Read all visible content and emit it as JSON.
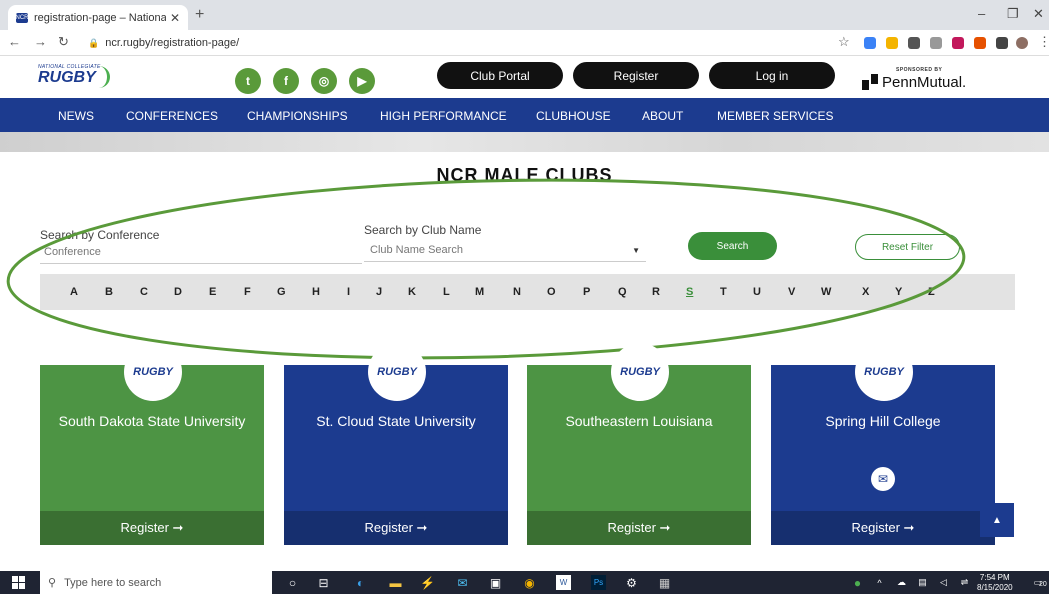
{
  "browser": {
    "tab_title": "registration-page – National Coll",
    "tab_favicon": "NCR",
    "url": "ncr.rugby/registration-page/"
  },
  "header": {
    "logo_small": "NATIONAL COLLEGIATE",
    "logo_big": "RUGBY",
    "social": [
      "twitter-icon",
      "facebook-icon",
      "instagram-icon",
      "youtube-icon"
    ],
    "club_portal": "Club Portal",
    "register": "Register",
    "login": "Log in",
    "sponsor_label": "SPONSORED BY",
    "sponsor_name": "PennMutual."
  },
  "nav": [
    "NEWS",
    "CONFERENCES",
    "CHAMPIONSHIPS",
    "HIGH PERFORMANCE",
    "CLUBHOUSE",
    "ABOUT",
    "MEMBER SERVICES"
  ],
  "page_title": "NCR MALE CLUBS",
  "filters": {
    "conference_label": "Search by Conference",
    "conference_placeholder": "Conference",
    "club_label": "Search by Club Name",
    "club_placeholder": "Club Name Search",
    "search_btn": "Search",
    "reset_btn": "Reset Filter"
  },
  "alphabet": [
    "A",
    "B",
    "C",
    "D",
    "E",
    "F",
    "G",
    "H",
    "I",
    "J",
    "K",
    "L",
    "M",
    "N",
    "O",
    "P",
    "Q",
    "R",
    "S",
    "T",
    "U",
    "V",
    "W",
    "X",
    "Y",
    "Z"
  ],
  "active_letter": "S",
  "cards": [
    {
      "name": "South Dakota State University",
      "register": "Register  ➞",
      "theme": "green"
    },
    {
      "name": "St. Cloud State University",
      "register": "Register  ➞",
      "theme": "blue"
    },
    {
      "name": "Southeastern Louisiana",
      "register": "Register  ➞",
      "theme": "green"
    },
    {
      "name": "Spring Hill College",
      "register": "Register  ➞",
      "theme": "blue"
    }
  ],
  "card_logo_text": "RUGBY",
  "taskbar": {
    "search_placeholder": "Type here to search",
    "time": "7:54 PM",
    "date": "8/15/2020",
    "notification_count": "20"
  },
  "colors": {
    "brand_blue": "#1c3b8f",
    "brand_green": "#4d9444",
    "annotation_green": "#5a9a3a"
  }
}
